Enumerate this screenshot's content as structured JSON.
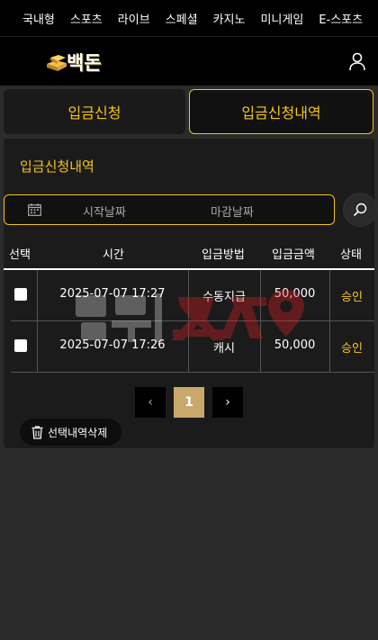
{
  "topnav": {
    "items": [
      "국내형",
      "스포츠",
      "라이브",
      "스페셜",
      "카지노",
      "미니게임",
      "E-스포츠"
    ]
  },
  "header": {
    "logo_text": "백돈",
    "user_icon": "user-icon"
  },
  "tabs": [
    {
      "label": "입금신청",
      "active": false
    },
    {
      "label": "입금신청내역",
      "active": true
    }
  ],
  "panel": {
    "title": "입금신청내역",
    "start_date_placeholder": "시작날짜",
    "end_date_placeholder": "마감날짜",
    "calendar_icon": "calendar-icon",
    "search_icon": "search-icon"
  },
  "table": {
    "headers": [
      "선택",
      "시간",
      "입금방법",
      "입금금액",
      "상태"
    ],
    "rows": [
      {
        "time": "2025-07-07 17:27",
        "method": "수동지급",
        "amount": "50,000",
        "status": "승인"
      },
      {
        "time": "2025-07-07 17:26",
        "method": "캐시",
        "amount": "50,000",
        "status": "승인"
      }
    ]
  },
  "pagination": {
    "prev": "‹",
    "current": "1",
    "next": "›"
  },
  "actions": {
    "delete_label": "선택내역삭제",
    "delete_icon": "trash-icon"
  },
  "colors": {
    "accent": "#f5c518",
    "background": "#2b2b2b",
    "panel": "#1b1b1b",
    "nav": "#000000",
    "page_active": "#c9a86b"
  }
}
